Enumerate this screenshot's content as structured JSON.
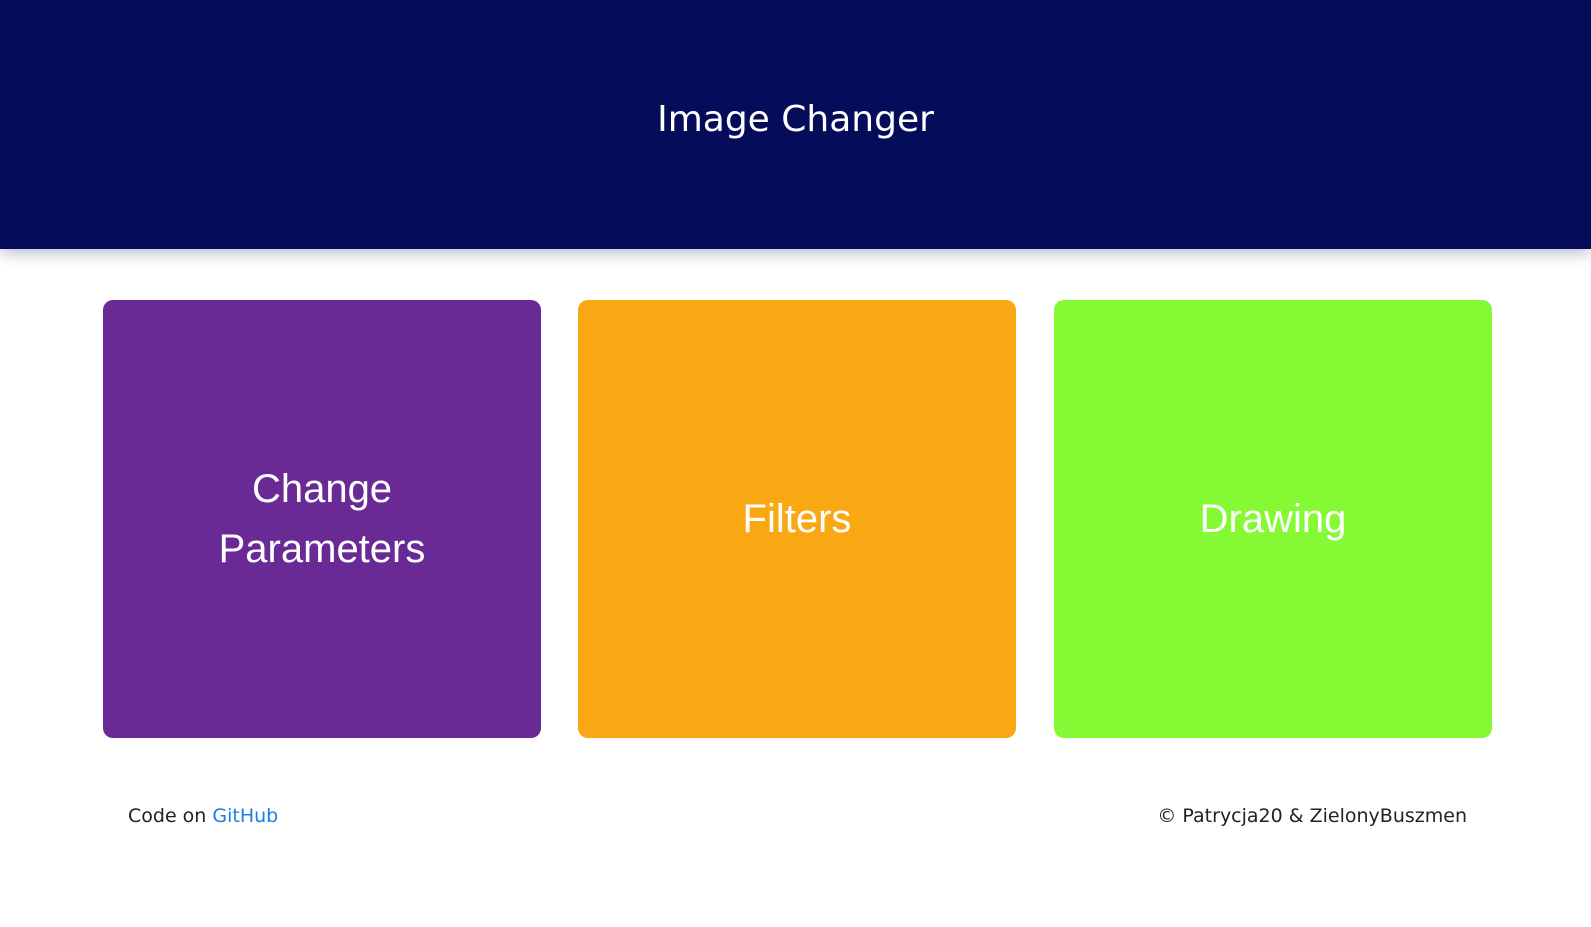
{
  "header": {
    "title": "Image Changer",
    "background": "#050c5a"
  },
  "tiles": [
    {
      "label": "Change Parameters",
      "color": "#692a96"
    },
    {
      "label": "Filters",
      "color": "#f9a713"
    },
    {
      "label": "Drawing",
      "color": "#85f934"
    }
  ],
  "footer": {
    "code_prefix": "Code on",
    "github_link": "GitHub",
    "link_color": "#1f7ce8",
    "copyright": "© Patrycja20 & ZielonyBuszmen"
  }
}
